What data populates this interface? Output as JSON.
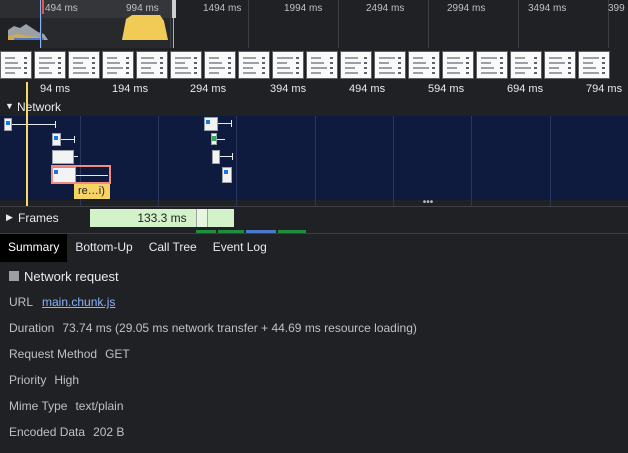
{
  "overview": {
    "ticks": [
      "494 ms",
      "994 ms",
      "1494 ms",
      "1994 ms",
      "2494 ms",
      "2994 ms",
      "3494 ms",
      "399"
    ]
  },
  "ruler": {
    "ticks": [
      "94 ms",
      "194 ms",
      "294 ms",
      "394 ms",
      "494 ms",
      "594 ms",
      "694 ms",
      "794 ms"
    ]
  },
  "network": {
    "label": "Network",
    "tooltip": "re…i)"
  },
  "frames": {
    "label": "Frames",
    "frame_duration": "133.3 ms"
  },
  "tabs": [
    "Summary",
    "Bottom-Up",
    "Call Tree",
    "Event Log"
  ],
  "summary": {
    "title": "Network request",
    "url_label": "URL",
    "url_value": "main.chunk.js",
    "duration_label": "Duration",
    "duration_value": "73.74 ms (29.05 ms network transfer + 44.69 ms resource loading)",
    "method_label": "Request Method",
    "method_value": "GET",
    "priority_label": "Priority",
    "priority_value": "High",
    "mime_label": "Mime Type",
    "mime_value": "text/plain",
    "encoded_label": "Encoded Data",
    "encoded_value": "202 B"
  },
  "colors": {
    "network_bg": "#0e1b3f",
    "selection": "#f28b82",
    "tooltip": "#f6d365",
    "frame_bar": "#d4f2c9",
    "cpu_yellow": "#f0c94f",
    "link": "#8ab4f8"
  }
}
